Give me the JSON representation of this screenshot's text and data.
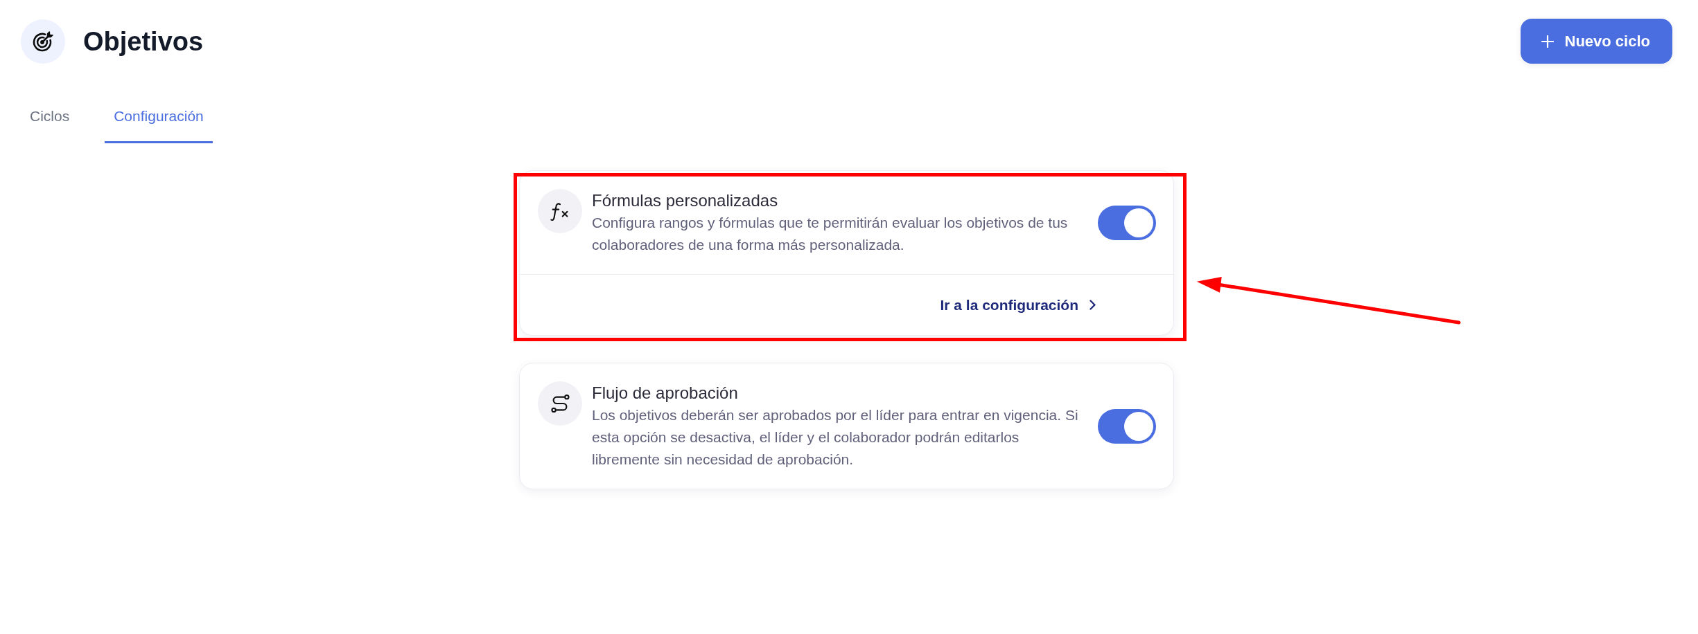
{
  "header": {
    "title": "Objetivos",
    "primary_button": {
      "label": "Nuevo ciclo"
    }
  },
  "tabs": [
    {
      "label": "Ciclos",
      "selected": false
    },
    {
      "label": "Configuración",
      "selected": true
    }
  ],
  "settings": [
    {
      "kind": "formula",
      "title": "Fórmulas personalizadas",
      "description": "Configura rangos y fórmulas que te permitirán evaluar los objetivos de tus colaboradores de una forma más personalizada.",
      "on": true,
      "highlighted": true,
      "link": {
        "label": "Ir a la configuración"
      }
    },
    {
      "kind": "approval",
      "title": "Flujo de aprobación",
      "description": "Los objetivos deberán ser aprobados por el líder para entrar en vigencia. Si esta opción se desactiva, el líder y el colaborador podrán editarlos libremente sin necesidad de aprobación.",
      "on": true,
      "highlighted": false
    }
  ]
}
